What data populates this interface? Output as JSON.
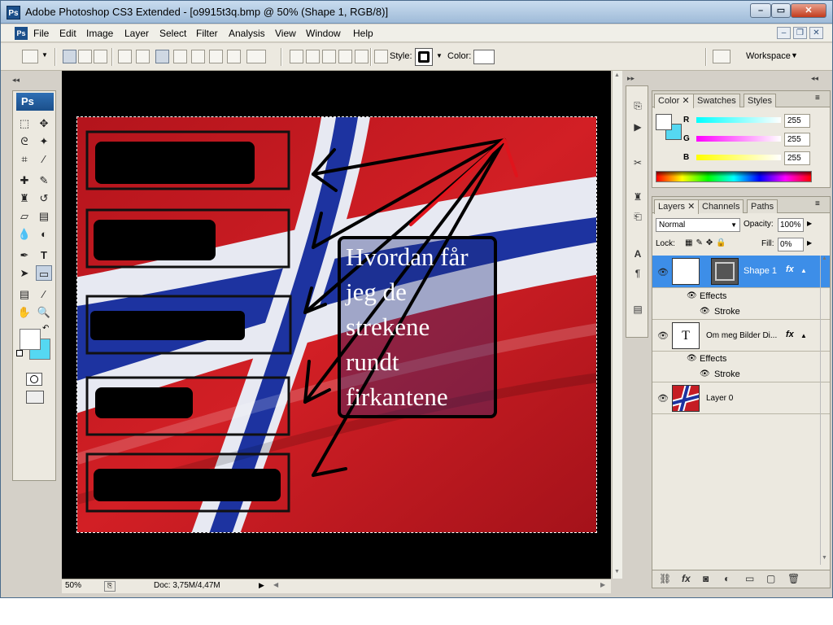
{
  "window": {
    "title": "Adobe Photoshop CS3 Extended - [o9915t3q.bmp @ 50% (Shape 1, RGB/8)]",
    "app_icon": "Ps"
  },
  "menu": [
    "File",
    "Edit",
    "Image",
    "Layer",
    "Select",
    "Filter",
    "Analysis",
    "View",
    "Window",
    "Help"
  ],
  "options_bar": {
    "style_label": "Style:",
    "color_label": "Color:",
    "workspace_label": "Workspace"
  },
  "toolbox": {
    "badge": "Ps"
  },
  "status": {
    "zoom": "50%",
    "doc": "Doc: 3,75M/4,47M"
  },
  "canvas": {
    "question": [
      "Hvordan får",
      "jeg de",
      "strekene",
      "rundt",
      "firkantene"
    ]
  },
  "color_panel": {
    "tabs": [
      "Color",
      "Swatches",
      "Styles"
    ],
    "channels": [
      {
        "label": "R",
        "value": "255"
      },
      {
        "label": "G",
        "value": "255"
      },
      {
        "label": "B",
        "value": "255"
      }
    ]
  },
  "layers_panel": {
    "tabs": [
      "Layers",
      "Channels",
      "Paths"
    ],
    "blend_mode": "Normal",
    "opacity_label": "Opacity:",
    "opacity_value": "100%",
    "lock_label": "Lock:",
    "fill_label": "Fill:",
    "fill_value": "0%",
    "layers": [
      {
        "name": "Shape 1",
        "fx": "fx",
        "effects_label": "Effects",
        "effect": "Stroke"
      },
      {
        "name": "Om meg  Bilder  Di...",
        "fx": "fx",
        "effects_label": "Effects",
        "effect": "Stroke"
      },
      {
        "name": "Layer 0"
      }
    ]
  },
  "colors": {
    "accent_selected": "#3d8ee8",
    "foreground_swatch": "#ffffff",
    "background_swatch": "#55d8f2"
  }
}
